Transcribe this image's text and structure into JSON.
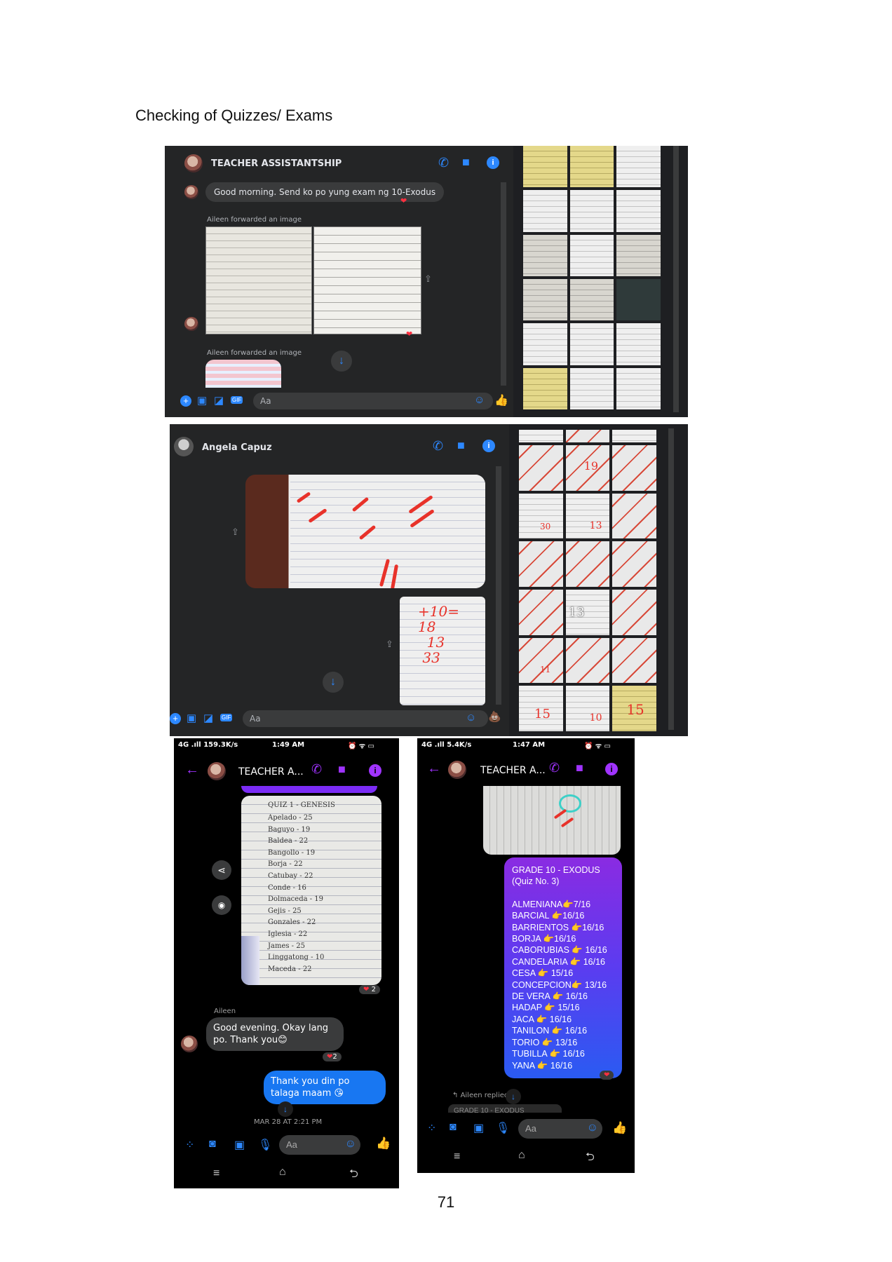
{
  "heading": "Checking of Quizzes/ Exams",
  "page_number": "71",
  "panel1": {
    "title": "TEACHER ASSISTANTSHIP",
    "message": "Good morning. Send ko po yung exam ng 10-Exodus",
    "forward_note_1": "Aileen forwarded an image",
    "forward_note_2": "Aileen forwarded an image",
    "input_placeholder": "Aa"
  },
  "panel2": {
    "title": "Angela Capuz",
    "input_placeholder": "Aa",
    "thumb_numbers": [
      "19",
      "30",
      "13",
      "13",
      "11",
      "15",
      "10",
      "15"
    ]
  },
  "phone1": {
    "status_left": "4G .ıll 159.3K/s",
    "time": "1:49 AM",
    "title": "TEACHER A...",
    "quiz_title": "QUIZ 1 - GENESIS",
    "quiz_lines": [
      "Apelado - 25",
      "Baguyo - 19",
      "Baldea - 22",
      "Bangollo - 19",
      "Borja - 22",
      "Catubay - 22",
      "Conde - 16",
      "Dolmaceda - 19",
      "Gejis - 25",
      "Gonzales - 22",
      "Iglesia - 22",
      "James - 25",
      "Linggatong - 10",
      "Maceda - 22"
    ],
    "reaction_1": "2",
    "sender": "Aileen",
    "msg_received": "Good evening. Okay lang po. Thank you😊",
    "reaction_2": "2",
    "msg_sent": "Thank you din po talaga maam 😘",
    "timestamp": "MAR 28 AT 2:21 PM",
    "input_placeholder": "Aa"
  },
  "phone2": {
    "status_left": "4G .ıll 5.4K/s",
    "time": "1:47 AM",
    "title": "TEACHER A...",
    "grade_heading": "GRADE 10 - EXODUS",
    "quiz_no": "(Quiz No. 3)",
    "scores": [
      "ALMENIANA👉7/16",
      "BARCIAL 👉16/16",
      "BARRIENTOS 👉16/16",
      "BORJA 👉16/16",
      "CABORUBIAS 👉 16/16",
      "CANDELARIA 👉 16/16",
      "CESA 👉 15/16",
      "CONCEPCION👉 13/16",
      "DE VERA 👉 16/16",
      "HADAP 👉 15/16",
      "JACA 👉 16/16",
      "TANILON 👉 16/16",
      "TORIO 👉 13/16",
      "TUBILLA 👉 16/16",
      "YANA 👉 16/16"
    ],
    "replied_note": "Aileen replied t",
    "cut_text": "GRADE 10 - EXODUS",
    "input_placeholder": "Aa"
  },
  "colors": {
    "messenger_blue": "#2d88ff",
    "messenger_purple": "#a033ff",
    "dark_bg": "#242526",
    "mark_red": "#e8322a"
  },
  "icons": [
    "phone-icon",
    "video-icon",
    "info-icon",
    "plus-icon",
    "image-icon",
    "sticker-icon",
    "gif-icon",
    "emoji-icon",
    "like-icon",
    "back-arrow-icon",
    "camera-icon",
    "mic-icon",
    "share-icon",
    "download-arrow-icon",
    "menu-icon",
    "home-icon",
    "back-nav-icon"
  ]
}
